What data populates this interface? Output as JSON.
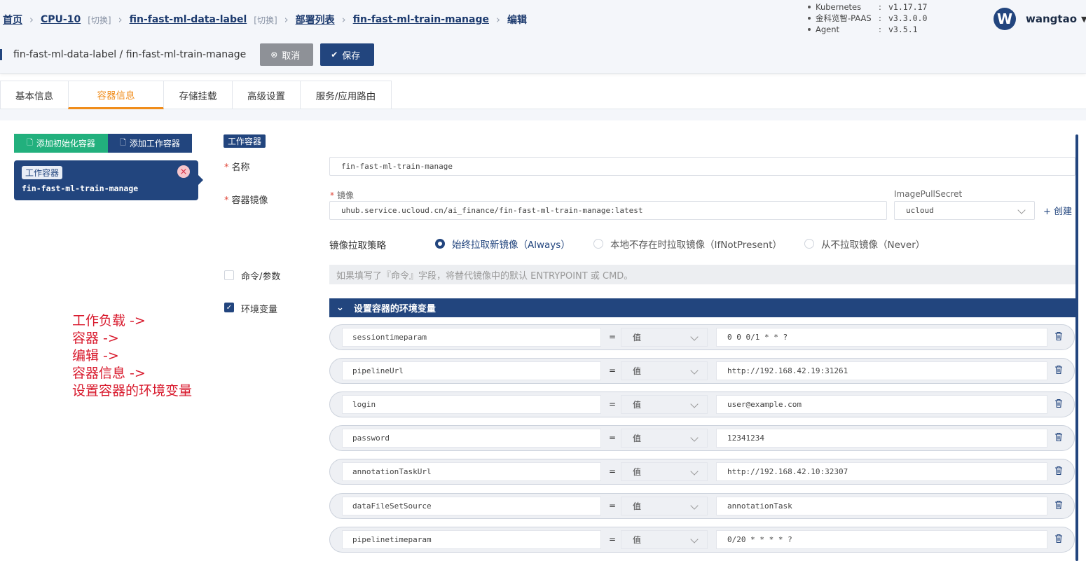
{
  "breadcrumb": {
    "home": "首页",
    "cluster": "CPU-10",
    "switch_label": "[切换]",
    "namespace": "fin-fast-ml-data-label",
    "deploy_list": "部署列表",
    "deployment": "fin-fast-ml-train-manage",
    "current": "编辑"
  },
  "versions": [
    {
      "name": "Kubernetes",
      "value": "v1.17.17"
    },
    {
      "name": "金科览智-PAAS",
      "value": "v3.3.0.0"
    },
    {
      "name": "Agent",
      "value": "v3.5.1"
    }
  ],
  "user": {
    "avatar_letter": "W",
    "name": "wangtao"
  },
  "page": {
    "title": "fin-fast-ml-data-label / fin-fast-ml-train-manage",
    "cancel_label": "取消",
    "save_label": "保存"
  },
  "tabs": [
    "基本信息",
    "容器信息",
    "存储挂载",
    "高级设置",
    "服务/应用路由"
  ],
  "active_tab": "容器信息",
  "left": {
    "add_init_label": "添加初始化容器",
    "add_work_label": "添加工作容器",
    "card_tag": "工作容器",
    "card_name": "fin-fast-ml-train-manage"
  },
  "annotation": [
    "工作负载 ->",
    "容器 ->",
    "编辑 ->",
    "容器信息 ->",
    "设置容器的环境变量"
  ],
  "form": {
    "section_tag": "工作容器",
    "name_label": "名称",
    "name_value": "fin-fast-ml-train-manage",
    "image_label": "容器镜像",
    "image_sublabel": "镜像",
    "image_value": "uhub.service.ucloud.cn/ai_finance/fin-fast-ml-train-manage:latest",
    "pull_secret_label": "ImagePullSecret",
    "pull_secret_value": "ucloud",
    "create_label": "+ 创建",
    "pull_policy_label": "镜像拉取策略",
    "pull_policy_options": [
      "始终拉取新镜像（Always）",
      "本地不存在时拉取镜像（IfNotPresent）",
      "从不拉取镜像（Never）"
    ],
    "pull_policy_selected": 0,
    "cmd_label": "命令/参数",
    "cmd_checked": false,
    "cmd_placeholder": "如果填写了『命令』字段，将替代镜像中的默认 ENTRYPOINT 或 CMD。",
    "env_label": "环境变量",
    "env_checked": true,
    "env_header": "设置容器的环境变量",
    "env_vars": [
      {
        "key": "sessiontimeparam",
        "type": "值",
        "value": "0 0 0/1 * * ?"
      },
      {
        "key": "pipelineUrl",
        "type": "值",
        "value": "http://192.168.42.19:31261"
      },
      {
        "key": "login",
        "type": "值",
        "value": "user@example.com"
      },
      {
        "key": "password",
        "type": "值",
        "value": "12341234"
      },
      {
        "key": "annotationTaskUrl",
        "type": "值",
        "value": "http://192.168.42.10:32307"
      },
      {
        "key": "dataFileSetSource",
        "type": "值",
        "value": "annotationTask"
      },
      {
        "key": "pipelinetimeparam",
        "type": "值",
        "value": "0/20 * * * * ?"
      }
    ]
  },
  "colors": {
    "primary": "#22457e",
    "accent": "#f08c1a",
    "success": "#22b07d",
    "annotation": "#d8192c"
  }
}
